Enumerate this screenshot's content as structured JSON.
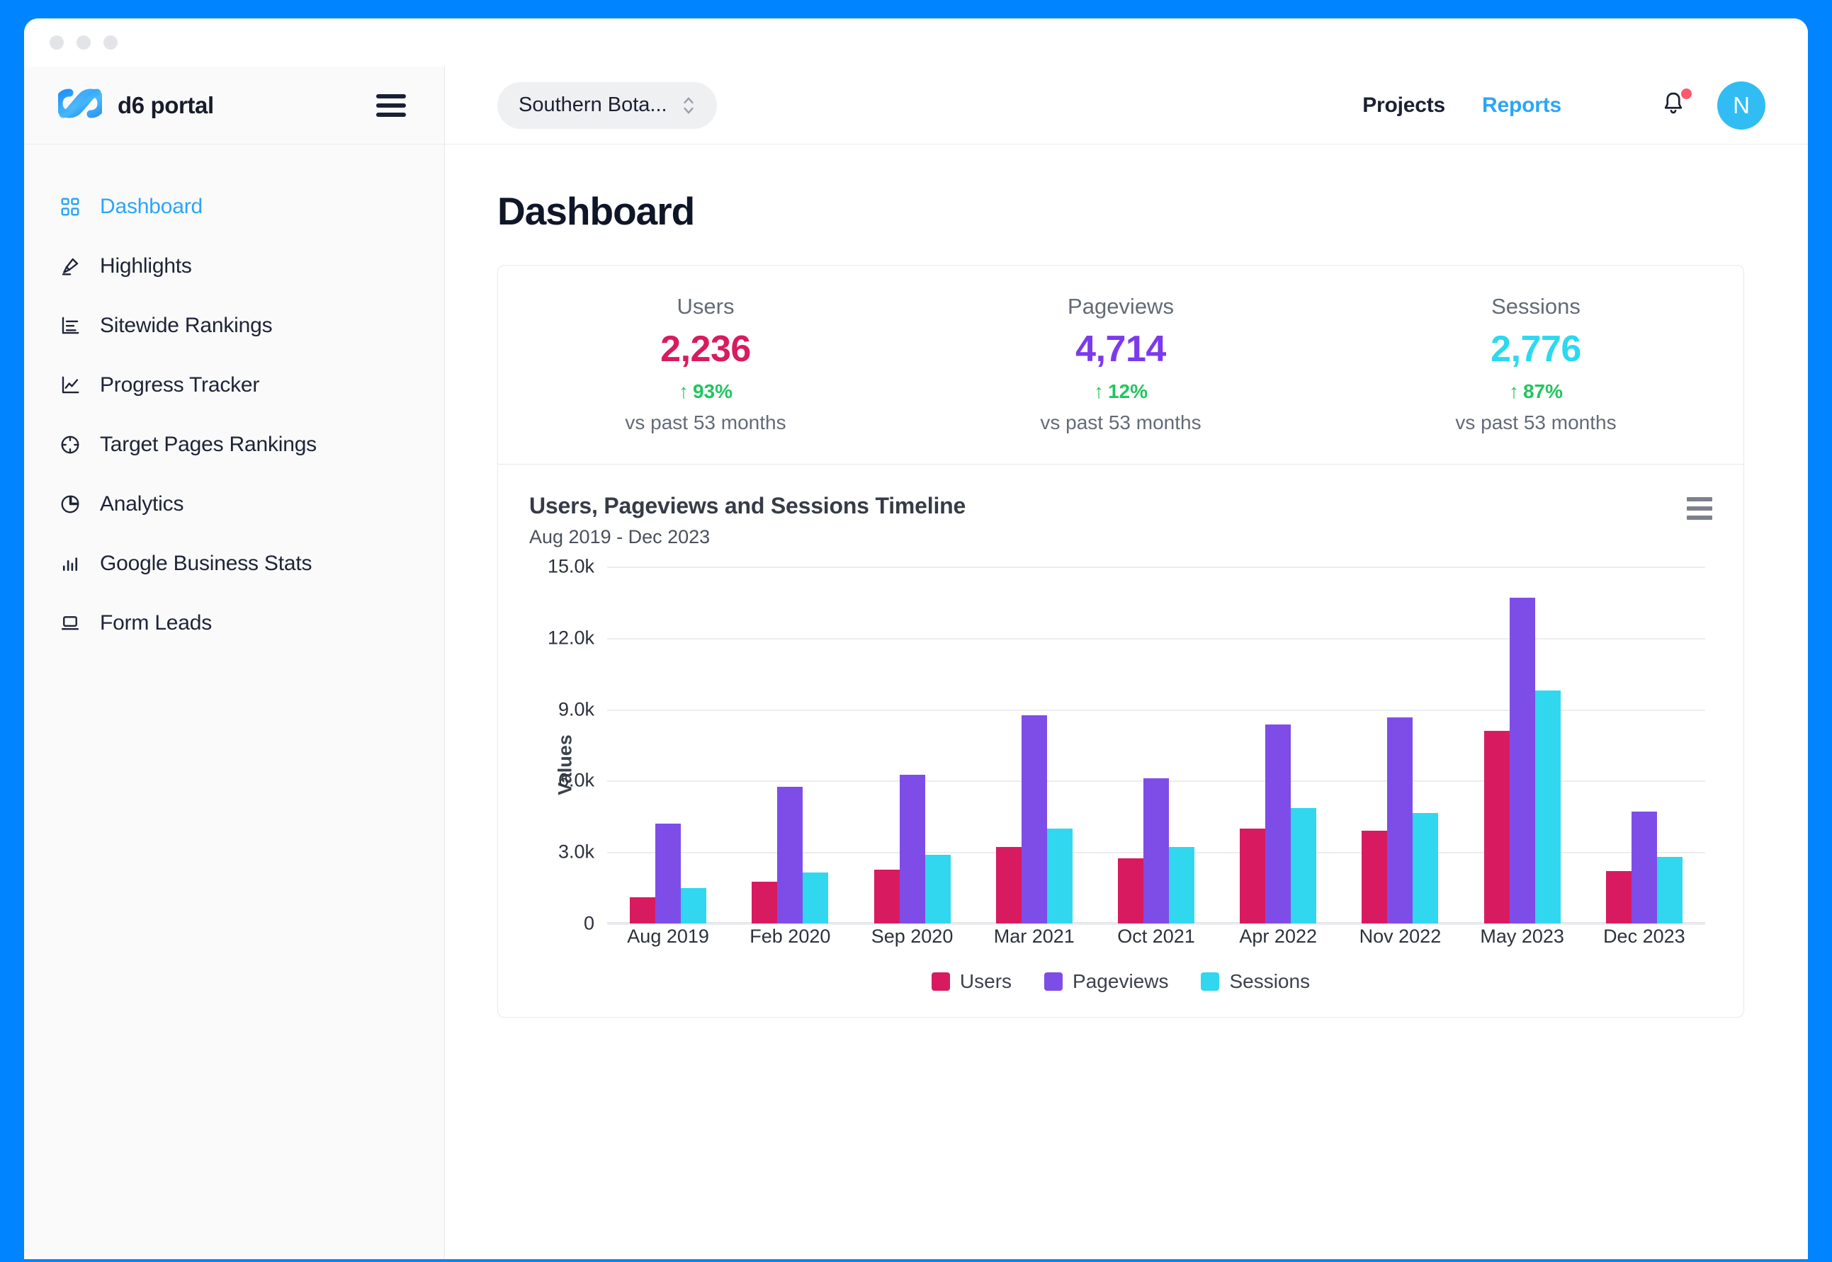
{
  "window": {
    "dots": [
      "close",
      "minimize",
      "maximize"
    ]
  },
  "brand": {
    "name": "d6 portal",
    "logo_icon": "infinity-logo",
    "menu_icon": "hamburger-menu-icon"
  },
  "sidebar": {
    "items": [
      {
        "label": "Dashboard",
        "icon": "grid-icon",
        "active": true
      },
      {
        "label": "Highlights",
        "icon": "highlighter-icon",
        "active": false
      },
      {
        "label": "Sitewide Rankings",
        "icon": "bar-list-icon",
        "active": false
      },
      {
        "label": "Progress Tracker",
        "icon": "line-chart-icon",
        "active": false
      },
      {
        "label": "Target Pages Rankings",
        "icon": "crosshair-icon",
        "active": false
      },
      {
        "label": "Analytics",
        "icon": "pie-chart-icon",
        "active": false
      },
      {
        "label": "Google Business Stats",
        "icon": "bar-chart-icon",
        "active": false
      },
      {
        "label": "Form Leads",
        "icon": "laptop-icon",
        "active": false
      }
    ]
  },
  "topbar": {
    "project_selector": {
      "value": "Southern Bota...",
      "icon": "chevron-up-down-icon"
    },
    "nav": [
      {
        "label": "Projects",
        "active": false
      },
      {
        "label": "Reports",
        "active": true
      }
    ],
    "notifications": {
      "icon": "bell-icon",
      "has_badge": true,
      "badge_color": "#FB5A6E"
    },
    "avatar": {
      "initial": "N",
      "color": "#31BDF4"
    }
  },
  "page": {
    "title": "Dashboard"
  },
  "kpis": [
    {
      "label": "Users",
      "value": "2,236",
      "color": "#D81B60",
      "delta": "93%",
      "delta_arrow": "↑",
      "delta_color": "#22C55E",
      "sub": "vs past 53 months"
    },
    {
      "label": "Pageviews",
      "value": "4,714",
      "color": "#7C3AED",
      "delta": "12%",
      "delta_arrow": "↑",
      "delta_color": "#22C55E",
      "sub": "vs past 53 months"
    },
    {
      "label": "Sessions",
      "value": "2,776",
      "color": "#2BD9F0",
      "delta": "87%",
      "delta_arrow": "↑",
      "delta_color": "#22C55E",
      "sub": "vs past 53 months"
    }
  ],
  "chart_panel": {
    "title": "Users, Pageviews and Sessions Timeline",
    "subtitle": "Aug 2019 - Dec 2023",
    "menu_icon": "hamburger-menu-icon"
  },
  "chart_data": {
    "type": "bar",
    "title": "Users, Pageviews and Sessions Timeline",
    "subtitle": "Aug 2019 - Dec 2023",
    "xlabel": "",
    "ylabel": "Values",
    "ylim": [
      0,
      15000
    ],
    "yticks": [
      0,
      3000,
      6000,
      9000,
      12000,
      15000
    ],
    "ytick_labels": [
      "0",
      "3.0k",
      "6.0k",
      "9.0k",
      "12.0k",
      "15.0k"
    ],
    "grid": true,
    "legend_position": "bottom",
    "categories": [
      "Aug 2019",
      "Feb 2020",
      "Sep 2020",
      "Mar 2021",
      "Oct 2021",
      "Apr 2022",
      "Nov 2022",
      "May 2023",
      "Dec 2023"
    ],
    "series": [
      {
        "name": "Users",
        "color": "#D81B60",
        "values": [
          1100,
          1750,
          2250,
          3200,
          2750,
          4000,
          3900,
          8100,
          2200
        ]
      },
      {
        "name": "Pageviews",
        "color": "#7E4DE8",
        "values": [
          4200,
          5750,
          6250,
          8750,
          6100,
          8350,
          8650,
          13700,
          4700
        ]
      },
      {
        "name": "Sessions",
        "color": "#31D7EF",
        "values": [
          1500,
          2150,
          2900,
          4000,
          3200,
          4850,
          4650,
          9800,
          2800
        ]
      }
    ]
  }
}
